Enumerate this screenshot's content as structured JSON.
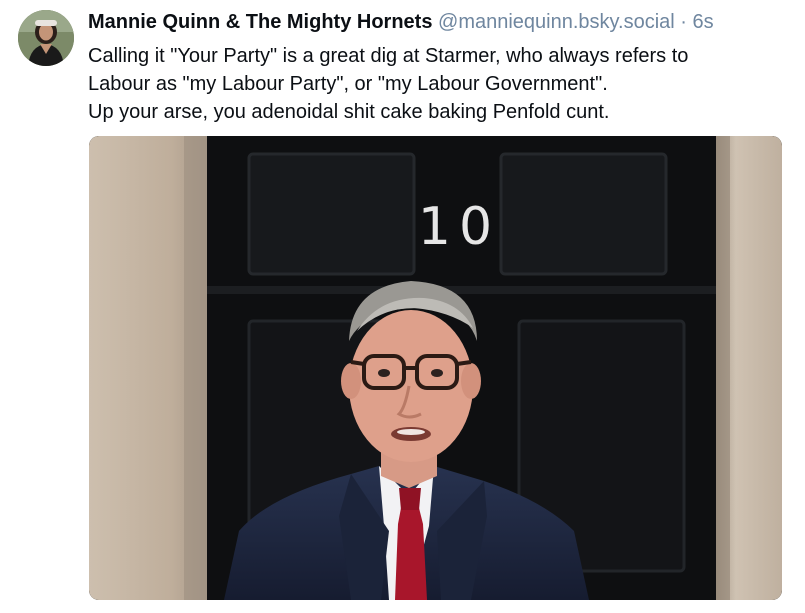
{
  "post": {
    "author": {
      "display_name": "Mannie Quinn & The Mighty Hornets",
      "handle": "@manniequinn.bsky.social",
      "avatar_icon": "avatar-photo"
    },
    "separator": "·",
    "timestamp": "6s",
    "text_lines": [
      "Calling it \"Your Party\" is a great dig at Starmer, who always refers to",
      "Labour as \"my Labour Party\", or \"my Labour Government\".",
      "Up your arse, you adenoidal shit cake baking Penfold cunt."
    ],
    "image": {
      "door_number": "10"
    }
  },
  "colors": {
    "text": "#0b0f14",
    "muted": "#6f869f",
    "door": "#0f1012",
    "stone": "#c7b8a6",
    "suit": "#1e2740",
    "tie": "#a8162b"
  }
}
